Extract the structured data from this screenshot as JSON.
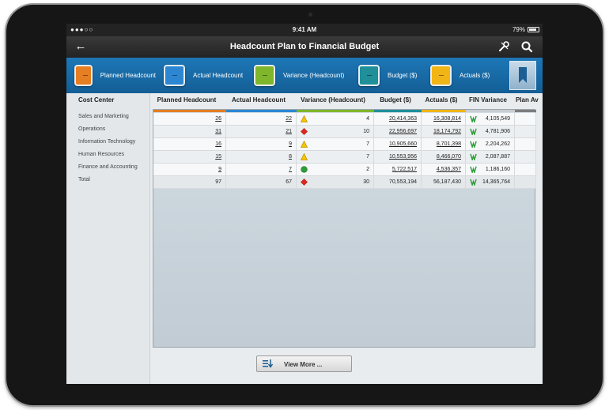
{
  "status_bar": {
    "signal": "●●●○○",
    "time": "9:41 AM",
    "battery": "79%"
  },
  "header": {
    "title": "Headcount Plan to Financial Budget"
  },
  "tabs": [
    {
      "label": "Planned Headcount",
      "color": "#e67e22"
    },
    {
      "label": "Actual Headcount",
      "color": "#2c86d2"
    },
    {
      "label": "Variance (Headcount)",
      "color": "#7fb62b"
    },
    {
      "label": "Budget ($)",
      "color": "#1f8f9a"
    },
    {
      "label": "Actuals ($)",
      "color": "#f1b516"
    }
  ],
  "sidebar": {
    "header": "Cost Center",
    "items": [
      "Sales and Marketing",
      "Operations",
      "Information Technology",
      "Human Resources",
      "Finance and Accounting",
      "Total"
    ]
  },
  "grid": {
    "columns": [
      "Planned Headcount",
      "Actual Headcount",
      "Variance (Headcount)",
      "Budget ($)",
      "Actuals ($)",
      "FIN Variance",
      "Plan Av"
    ],
    "column_colors": [
      "#e67e22",
      "#2c86d2",
      "#7fb62b",
      "#1f8f9a",
      "#f1b516",
      "#c9ced2",
      "#7d7d7d"
    ],
    "rows": [
      {
        "planned": "26",
        "actual": "22",
        "variance_icon": "warning-triangle",
        "variance": "4",
        "budget": "20,414,363",
        "actuals": "16,308,814",
        "fin_variance": "4,105,549"
      },
      {
        "planned": "31",
        "actual": "21",
        "variance_icon": "red-diamond",
        "variance": "10",
        "budget": "22,956,697",
        "actuals": "18,174,792",
        "fin_variance": "4,781,906"
      },
      {
        "planned": "16",
        "actual": "9",
        "variance_icon": "warning-triangle",
        "variance": "7",
        "budget": "10,905,660",
        "actuals": "8,701,398",
        "fin_variance": "2,204,262"
      },
      {
        "planned": "15",
        "actual": "8",
        "variance_icon": "warning-triangle",
        "variance": "7",
        "budget": "10,553,956",
        "actuals": "8,466,070",
        "fin_variance": "2,087,887"
      },
      {
        "planned": "9",
        "actual": "7",
        "variance_icon": "green-circle",
        "variance": "2",
        "budget": "5,722,517",
        "actuals": "4,536,357",
        "fin_variance": "1,186,160"
      },
      {
        "planned": "97",
        "actual": "67",
        "variance_icon": "red-diamond",
        "variance": "30",
        "budget": "70,553,194",
        "actuals": "56,187,430",
        "fin_variance": "14,365,764"
      }
    ]
  },
  "footer": {
    "view_more_label": "View More ..."
  }
}
